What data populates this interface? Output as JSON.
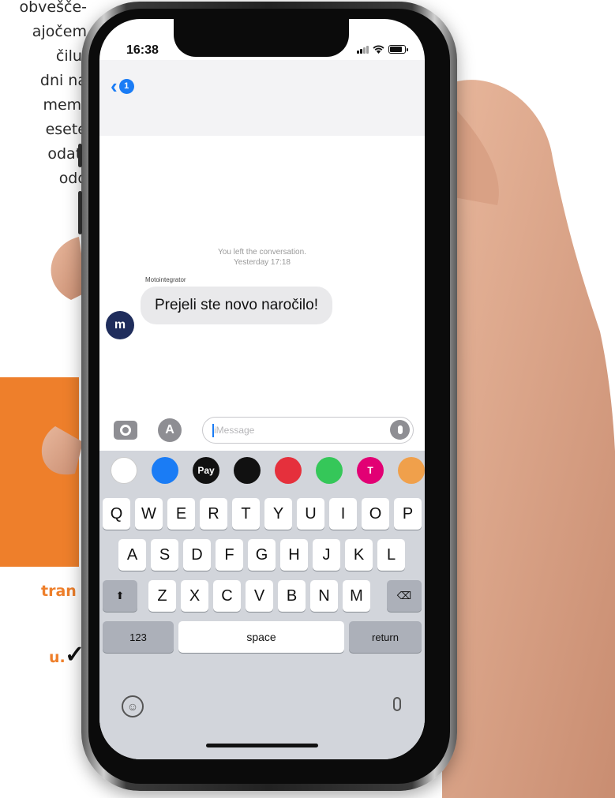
{
  "background_doc": {
    "lines": [
      "obvešče-",
      "ajočem",
      "čilu.",
      "dni na",
      "mem-",
      "esete",
      "odat-",
      "odo"
    ],
    "orange_fragment_1": "tran",
    "orange_fragment_2": "u."
  },
  "status_bar": {
    "time": "16:38",
    "battery_level": 0.85
  },
  "header": {
    "back_badge": "1"
  },
  "conversation": {
    "notice_line1": "You left the conversation.",
    "notice_line2": "Yesterday 17:18",
    "sender_name": "Motointegrator",
    "message": "Prejeli ste novo naročilo!",
    "avatar_initials": "m"
  },
  "input": {
    "placeholder": "iMessage"
  },
  "app_strip": [
    {
      "icon": "photos-icon",
      "color": "#ffffff"
    },
    {
      "icon": "app-store-icon",
      "color": "#1a7cf5"
    },
    {
      "icon": "apple-pay-icon",
      "color": "#111111",
      "label": "Pay"
    },
    {
      "icon": "activity-icon",
      "color": "#111111"
    },
    {
      "icon": "music-icon",
      "color": "#e5303c"
    },
    {
      "icon": "clock-icon",
      "color": "#35c759"
    },
    {
      "icon": "t-mobile-icon",
      "color": "#e20074",
      "label": "T"
    },
    {
      "icon": "animoji-icon",
      "color": "#f0a04b"
    }
  ],
  "keyboard": {
    "row1": [
      "Q",
      "W",
      "E",
      "R",
      "T",
      "Y",
      "U",
      "I",
      "O",
      "P"
    ],
    "row2": [
      "A",
      "S",
      "D",
      "F",
      "G",
      "H",
      "J",
      "K",
      "L"
    ],
    "row3": [
      "Z",
      "X",
      "C",
      "V",
      "B",
      "N",
      "M"
    ],
    "numbers_key": "123",
    "space_key": "space",
    "return_key": "return"
  },
  "colors": {
    "accent": "#1a7cf5",
    "orange": "#ee7f2b",
    "bubble": "#e9e9eb",
    "keyboard_bg": "#d2d5db"
  }
}
